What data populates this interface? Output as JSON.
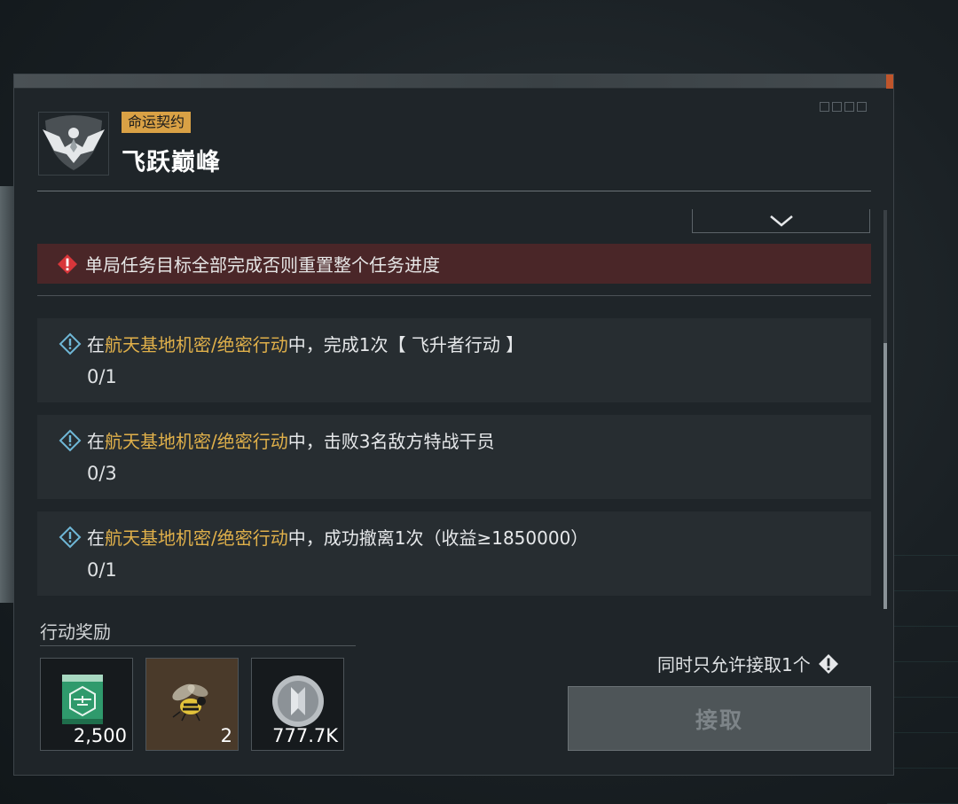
{
  "header": {
    "tag": "命运契约",
    "title": "飞跃巅峰",
    "emblem_icon": "eagle-emblem-icon"
  },
  "warning": {
    "text": "单局任务目标全部完成否则重置整个任务进度",
    "icon": "warning-diamond-icon",
    "color": "#4a2628"
  },
  "tasks": [
    {
      "prefix": "在",
      "location": "航天基地机密/绝密行动",
      "suffix": "中，完成1次【 飞升者行动 】",
      "progress": "0/1"
    },
    {
      "prefix": "在",
      "location": "航天基地机密/绝密行动",
      "suffix": "中，击败3名敌方特战干员",
      "progress": "0/3"
    },
    {
      "prefix": "在",
      "location": "航天基地机密/绝密行动",
      "suffix": "中，成功撤离1次（收益≥1850000）",
      "progress": "0/1"
    }
  ],
  "rewards": {
    "label": "行动奖励",
    "items": [
      {
        "icon": "helicopter-card-icon",
        "count": "2,500"
      },
      {
        "icon": "bee-icon",
        "count": "2"
      },
      {
        "icon": "coin-icon",
        "count": "777.7K"
      }
    ]
  },
  "footer": {
    "limit_note": "同时只允许接取1个",
    "accept_label": "接取"
  },
  "colors": {
    "highlight": "#e0b04a",
    "tag": "#d9a145"
  }
}
